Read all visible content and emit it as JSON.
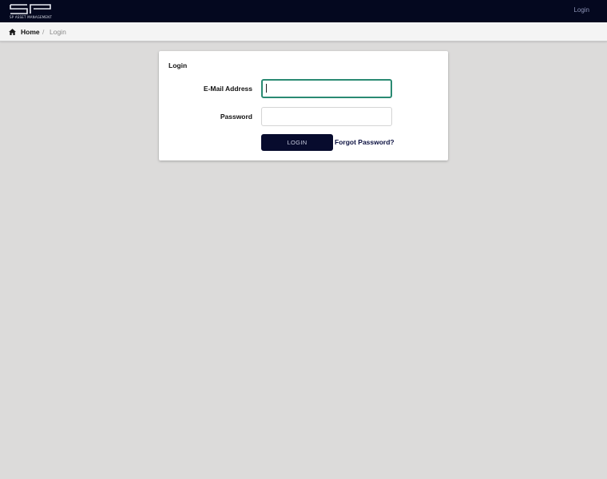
{
  "brand": {
    "logo_text": "SP",
    "tagline": "SP ASSET MANAGEMENT"
  },
  "topnav": {
    "login_label": "Login"
  },
  "breadcrumb": {
    "home_label": "Home",
    "separator": "/",
    "current_label": "Login"
  },
  "login_card": {
    "title": "Login",
    "email_label": "E-Mail Address",
    "email_value": "",
    "password_label": "Password",
    "password_value": "",
    "submit_label": "LOGIN",
    "forgot_label": "Forgot Password?"
  },
  "colors": {
    "topbar_bg": "#04081f",
    "accent_focus": "#2a8a72",
    "button_bg": "#070b2d",
    "page_bg": "#dcdbda"
  },
  "icons": {
    "home": "home-icon"
  }
}
